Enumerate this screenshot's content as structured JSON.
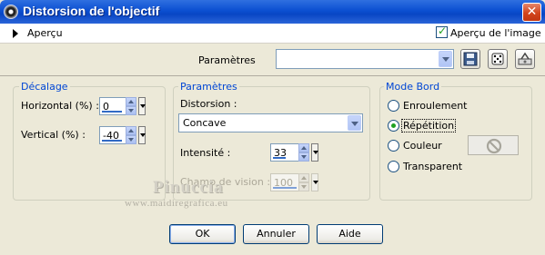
{
  "window": {
    "title": "Distorsion de l'objectif",
    "close_glyph": "✕"
  },
  "preview": {
    "toggle_label": "Aperçu",
    "image_preview_label": "Aperçu de l'image",
    "image_preview_checked": true
  },
  "params_row": {
    "label": "Paramètres",
    "preset_value": "",
    "tool_icons": [
      "save-icon",
      "dice-icon",
      "reset-icon"
    ]
  },
  "decalage": {
    "title": "Décalage",
    "horizontal_label": "Horizontal (%) :",
    "horizontal_value": "0",
    "vertical_label": "Vertical (%) :",
    "vertical_value": "-40"
  },
  "parametres": {
    "title": "Paramètres",
    "distorsion_label": "Distorsion :",
    "distorsion_value": "Concave",
    "intensite_label": "Intensité :",
    "intensite_value": "33",
    "champ_label": "Champ de vision :",
    "champ_value": "100",
    "champ_enabled": false
  },
  "mode_bord": {
    "title": "Mode Bord",
    "options": [
      "Enroulement",
      "Répétition",
      "Couleur",
      "Transparent"
    ],
    "selected": "Répétition",
    "color_icon": "no-symbol-icon"
  },
  "watermark": {
    "name": "Pinuccia",
    "url": "www.maidiregrafica.eu"
  },
  "buttons": {
    "ok": "OK",
    "cancel": "Annuler",
    "help": "Aide"
  },
  "colors": {
    "titlebar": "#0b4fd1",
    "group_title": "#0046d5",
    "dialog_bg": "#ece9d8",
    "check_green": "#21a121"
  }
}
